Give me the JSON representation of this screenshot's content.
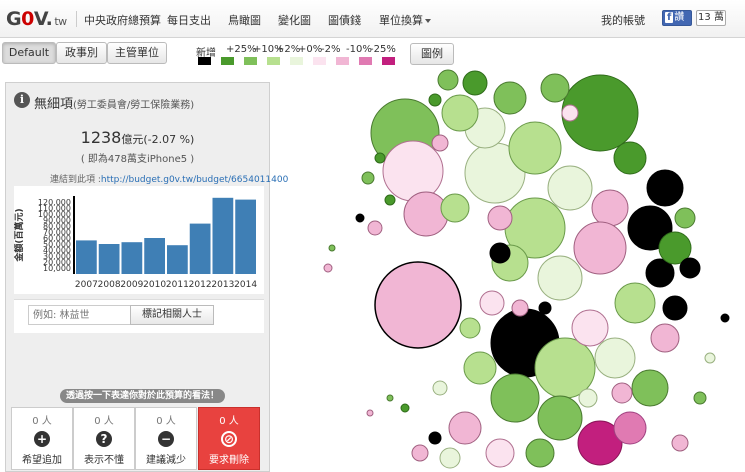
{
  "nav": {
    "logo_text": "G",
    "logo_zero": "0",
    "logo_v": "V.",
    "logo_tw": "tw",
    "site_title": "中央政府總預算",
    "items": [
      "每日支出",
      "鳥瞰圖",
      "變化圖",
      "圖債錢",
      "單位換算"
    ],
    "account": "我的帳號",
    "fb_label": "讚",
    "fb_count": "13 萬"
  },
  "toolbar": {
    "tabs": [
      "Default",
      "政事別",
      "主管單位"
    ],
    "legend_title": "新增",
    "legend_labels": [
      "+25%",
      "+10%",
      "+2%",
      "+0%",
      "-2%",
      "-10%",
      "-25%"
    ],
    "legend_colors": [
      "#000000",
      "#4a9a2c",
      "#7fc05a",
      "#b7e08f",
      "#e9f5dc",
      "#fbe3ef",
      "#f1b6d4",
      "#e07ab2",
      "#c21f7e"
    ],
    "chart_button": "圖例"
  },
  "panel": {
    "info_icon": "i",
    "title": "無細項",
    "subtitle": "(勞工委員會/勞工保險業務)",
    "amount": "1238",
    "amount_unit": "億元",
    "amount_change": "(-2.07 %)",
    "equivalent": "( 即為478萬支iPhone5 )",
    "link_prefix": "連結到此項 :",
    "link_url": "http://budget.g0v.tw/budget/6654011400",
    "search_placeholder": "例如: 林益世",
    "tag_button": "標記相關人士",
    "vote_banner": "透過按一下表達你對於此預算的看法！",
    "votes": [
      {
        "count": "0 人",
        "icon": "+",
        "label": "希望追加"
      },
      {
        "count": "0 人",
        "icon": "?",
        "label": "表示不懂"
      },
      {
        "count": "0 人",
        "icon": "−",
        "label": "建議減少"
      },
      {
        "count": "0 人",
        "icon": "⊘",
        "label": "要求刪除"
      }
    ]
  },
  "chart_data": {
    "type": "bar",
    "ylabel": "金額(百萬元)",
    "categories": [
      "2007",
      "2008",
      "2009",
      "2010",
      "2011",
      "2012",
      "2013",
      "2014"
    ],
    "values": [
      56000,
      50000,
      53000,
      60000,
      48000,
      84000,
      127000,
      124000
    ],
    "yticks": [
      "120,000",
      "110,000",
      "100,000",
      "90,000",
      "80,000",
      "70,000",
      "60,000",
      "50,000",
      "40,000",
      "30,000",
      "20,000",
      "10,000"
    ],
    "ylim": [
      0,
      130000
    ],
    "color": "#3f7fb5"
  }
}
